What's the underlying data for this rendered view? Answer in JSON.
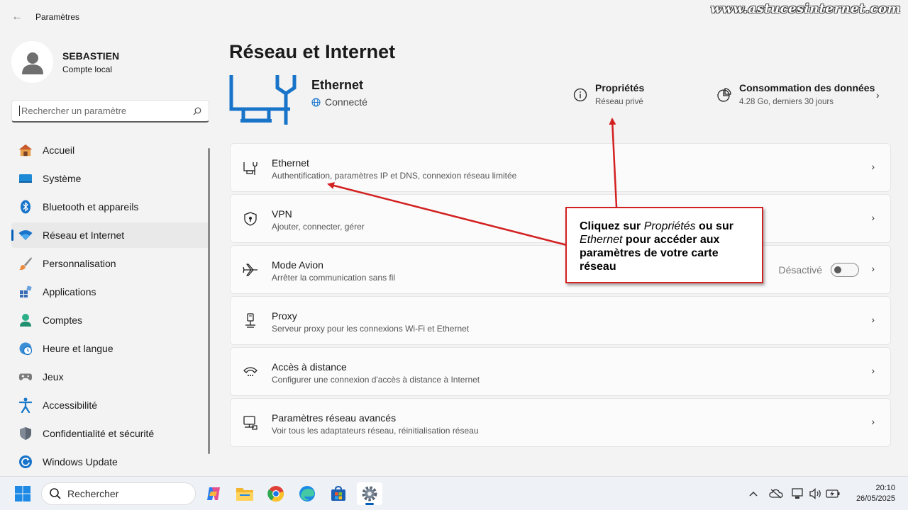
{
  "watermark": "www.astucesinternet.com",
  "titlebar": {
    "app_title": "Paramètres"
  },
  "user": {
    "name": "SEBASTIEN",
    "account": "Compte local"
  },
  "search": {
    "placeholder": "Rechercher un paramètre"
  },
  "nav": {
    "items": [
      {
        "label": "Accueil",
        "icon": "home-icon"
      },
      {
        "label": "Système",
        "icon": "display-icon"
      },
      {
        "label": "Bluetooth et appareils",
        "icon": "bluetooth-icon"
      },
      {
        "label": "Réseau et Internet",
        "icon": "wifi-icon",
        "active": true
      },
      {
        "label": "Personnalisation",
        "icon": "brush-icon"
      },
      {
        "label": "Applications",
        "icon": "apps-icon"
      },
      {
        "label": "Comptes",
        "icon": "person-icon"
      },
      {
        "label": "Heure et langue",
        "icon": "clock-globe-icon"
      },
      {
        "label": "Jeux",
        "icon": "gamepad-icon"
      },
      {
        "label": "Accessibilité",
        "icon": "accessibility-icon"
      },
      {
        "label": "Confidentialité et sécurité",
        "icon": "shield-icon"
      },
      {
        "label": "Windows Update",
        "icon": "update-icon"
      }
    ]
  },
  "main": {
    "title": "Réseau et Internet",
    "hero": {
      "name": "Ethernet",
      "status": "Connecté",
      "properties": {
        "title": "Propriétés",
        "subtitle": "Réseau privé"
      },
      "data_usage": {
        "title": "Consommation des données",
        "subtitle": "4.28 Go, derniers 30 jours"
      }
    },
    "cards": [
      {
        "title": "Ethernet",
        "desc": "Authentification, paramètres IP et DNS, connexion réseau limitée",
        "icon": "ethernet-icon"
      },
      {
        "title": "VPN",
        "desc": "Ajouter, connecter, gérer",
        "icon": "vpn-shield-icon"
      },
      {
        "title": "Mode Avion",
        "desc": "Arrêter la communication sans fil",
        "icon": "airplane-icon",
        "toggle_label": "Désactivé",
        "toggle_on": false
      },
      {
        "title": "Proxy",
        "desc": "Serveur proxy pour les connexions Wi-Fi et Ethernet",
        "icon": "proxy-icon"
      },
      {
        "title": "Accès à distance",
        "desc": "Configurer une connexion d'accès à distance à Internet",
        "icon": "dialup-icon"
      },
      {
        "title": "Paramètres réseau avancés",
        "desc": "Voir tous les adaptateurs réseau, réinitialisation réseau",
        "icon": "network-adapter-icon"
      }
    ]
  },
  "annotation": {
    "part1": "Cliquez sur ",
    "em1": "Propriétés",
    "part2": " ou sur ",
    "em2": "Ethernet",
    "part3": " pour accéder aux paramètres de votre carte réseau"
  },
  "taskbar": {
    "search_label": "Rechercher",
    "apps": [
      "copilot-icon",
      "file-explorer-icon",
      "chrome-icon",
      "edge-icon",
      "store-icon",
      "settings-icon"
    ],
    "time": "20:10",
    "date": "26/05/2025"
  },
  "colors": {
    "accent": "#005fb8",
    "annotation_red": "#d32020"
  }
}
